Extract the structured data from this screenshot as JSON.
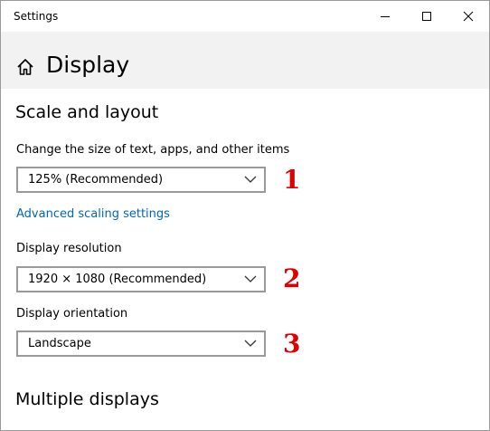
{
  "window": {
    "title": "Settings"
  },
  "header": {
    "home_icon": "home-icon",
    "title": "Display"
  },
  "scale_section": {
    "heading": "Scale and layout",
    "size_label": "Change the size of text, apps, and other items",
    "size_value": "125% (Recommended)",
    "advanced_link": "Advanced scaling settings",
    "resolution_label": "Display resolution",
    "resolution_value": "1920 × 1080 (Recommended)",
    "orientation_label": "Display orientation",
    "orientation_value": "Landscape"
  },
  "multiple_section": {
    "heading": "Multiple displays"
  },
  "annotations": {
    "marker_1": "1",
    "marker_2": "2",
    "marker_3": "3",
    "color": "#e00000"
  },
  "colors": {
    "header_bg": "#f2f2f2",
    "link": "#0067b8",
    "dropdown_border": "#999999"
  }
}
